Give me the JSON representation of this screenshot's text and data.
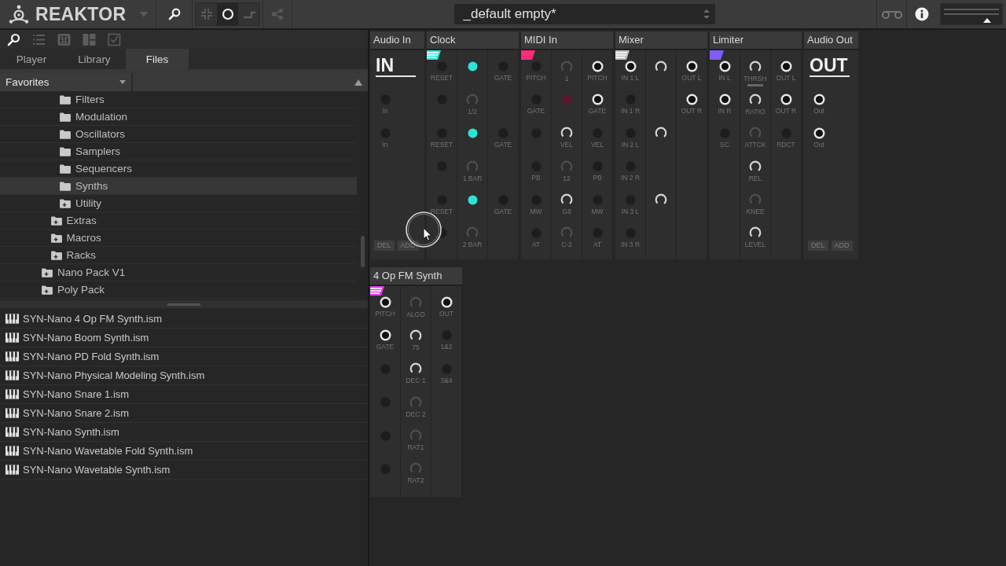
{
  "top_bar": {
    "app_name": "REAKTOR",
    "view_buttons": [
      {
        "selected": false
      },
      {
        "selected": true
      },
      {
        "selected": false
      }
    ],
    "share_button": {
      "disabled": true
    },
    "snapshot": "_default empty*",
    "master_volume": {
      "level": 0.75
    }
  },
  "browser": {
    "toolbar": [
      {
        "selected": true
      },
      {
        "selected": false
      },
      {
        "selected": false
      },
      {
        "selected": false
      },
      {
        "selected": false
      }
    ],
    "tabs": [
      {
        "label": "Player",
        "selected": false
      },
      {
        "label": "Library",
        "selected": false
      },
      {
        "label": "Files",
        "selected": true
      }
    ],
    "location": "Favorites",
    "tree": [
      {
        "children": [
          {
            "children": [
              {
                "label": "Filters",
                "expandable": false,
                "selected": false
              },
              {
                "label": "Modulation",
                "expandable": false,
                "selected": false
              },
              {
                "label": "Oscillators",
                "expandable": false,
                "selected": false
              },
              {
                "label": "Samplers",
                "expandable": false,
                "selected": false
              },
              {
                "label": "Sequencers",
                "expandable": false,
                "selected": false
              },
              {
                "label": "Synths",
                "expandable": false,
                "selected": true
              },
              {
                "label": "Utility",
                "expandable": true,
                "selected": false
              }
            ]
          },
          {
            "label": "Extras",
            "expandable": true,
            "selected": false
          },
          {
            "label": "Macros",
            "expandable": true,
            "selected": false
          },
          {
            "label": "Racks",
            "expandable": true,
            "selected": false
          }
        ]
      },
      {
        "label": "Nano Pack V1",
        "expandable": true,
        "selected": false
      },
      {
        "label": "Poly Pack",
        "expandable": true,
        "selected": false
      }
    ],
    "files": [
      "SYN-Nano 4 Op FM Synth.ism",
      "SYN-Nano Boom Synth.ism",
      "SYN-Nano PD Fold Synth.ism",
      "SYN-Nano Physical Modeling Synth.ism",
      "SYN-Nano Snare 1.ism",
      "SYN-Nano Snare 2.ism",
      "SYN-Nano Synth.ism",
      "SYN-Nano Wavetable Fold Synth.ism",
      "SYN-Nano Wavetable Synth.ism"
    ]
  },
  "canvas": {
    "top_row": [
      {
        "title": "Audio In",
        "kind": "io",
        "big_label": "IN",
        "ports": [
          {
            "label": "In",
            "on": false
          },
          {
            "label": "In",
            "on": false
          }
        ],
        "buttons": [
          "DEL",
          "ADD"
        ]
      },
      {
        "title": "Clock",
        "kind": "panel",
        "color": "#2ee3d3",
        "striped": true,
        "columns": [
          [
            {
              "kind": "jack",
              "label": "RESET",
              "on": false
            },
            {
              "kind": "jack",
              "on": false
            },
            {
              "kind": "jack",
              "label": "RESET",
              "on": false
            },
            {
              "kind": "jack",
              "on": false
            },
            {
              "kind": "jack",
              "label": "RESET",
              "on": false
            },
            {
              "kind": "jack",
              "on": false
            }
          ],
          [
            {
              "kind": "led",
              "on": true
            },
            {
              "kind": "knob",
              "label": "1/2",
              "on": false
            },
            {
              "kind": "led",
              "on": true
            },
            {
              "kind": "knob",
              "label": "1 BAR",
              "on": false
            },
            {
              "kind": "led",
              "on": true
            },
            {
              "kind": "knob",
              "label": "2 BAR",
              "on": false
            }
          ],
          [
            {
              "kind": "jack",
              "label": "GATE",
              "on": false
            },
            {
              "kind": "blank"
            },
            {
              "kind": "jack",
              "label": "GATE",
              "on": false
            },
            {
              "kind": "blank"
            },
            {
              "kind": "jack",
              "label": "GATE",
              "on": false
            },
            {
              "kind": "blank"
            }
          ]
        ]
      },
      {
        "title": "MIDI In",
        "kind": "panel",
        "color": "#ff2a78",
        "striped": false,
        "columns": [
          [
            {
              "kind": "jack",
              "label": "PITCH",
              "on": false
            },
            {
              "kind": "jack",
              "label": "GATE",
              "on": false
            },
            {
              "kind": "jack",
              "on": false
            },
            {
              "kind": "jack",
              "label": "PB",
              "on": false
            },
            {
              "kind": "jack",
              "label": "MW",
              "on": false
            },
            {
              "kind": "jack",
              "label": "AT",
              "on": false
            }
          ],
          [
            {
              "kind": "knob",
              "label": "1",
              "on": false
            },
            {
              "kind": "led",
              "on": false
            },
            {
              "kind": "knob",
              "label": "VEL",
              "on": true
            },
            {
              "kind": "knob",
              "label": "12",
              "on": false
            },
            {
              "kind": "knob",
              "label": "G8",
              "on": true
            },
            {
              "kind": "knob",
              "label": "C-2",
              "on": false
            }
          ],
          [
            {
              "kind": "jack",
              "label": "PITCH",
              "on": true
            },
            {
              "kind": "jack",
              "label": "GATE",
              "on": true
            },
            {
              "kind": "jack",
              "label": "VEL",
              "on": false
            },
            {
              "kind": "jack",
              "label": "PB",
              "on": false
            },
            {
              "kind": "jack",
              "label": "MW",
              "on": false
            },
            {
              "kind": "jack",
              "label": "AT",
              "on": false
            }
          ]
        ]
      },
      {
        "title": "Mixer",
        "kind": "panel",
        "color": "#bdbdbd",
        "striped": true,
        "columns": [
          [
            {
              "kind": "jack",
              "label": "IN 1 L",
              "on": true
            },
            {
              "kind": "jack",
              "label": "IN 1 R",
              "on": false
            },
            {
              "kind": "jack",
              "label": "IN 2 L",
              "on": false
            },
            {
              "kind": "jack",
              "label": "IN 2 R",
              "on": false
            },
            {
              "kind": "jack",
              "label": "IN 3 L",
              "on": false
            },
            {
              "kind": "jack",
              "label": "IN 3 R",
              "on": false
            }
          ],
          [
            {
              "kind": "knob",
              "on": true
            },
            {
              "kind": "blank"
            },
            {
              "kind": "knob",
              "on": true
            },
            {
              "kind": "blank"
            },
            {
              "kind": "knob",
              "on": true
            },
            {
              "kind": "blank"
            }
          ],
          [
            {
              "kind": "jack",
              "label": "OUT L",
              "on": true
            },
            {
              "kind": "jack",
              "label": "OUT R",
              "on": true
            }
          ]
        ]
      },
      {
        "title": "Limiter",
        "kind": "panel",
        "color": "#7f5cff",
        "striped": false,
        "columns": [
          [
            {
              "kind": "jack",
              "label": "IN L",
              "on": true
            },
            {
              "kind": "jack",
              "label": "IN R",
              "on": true
            },
            {
              "kind": "jack",
              "label": "SC",
              "on": false
            }
          ],
          [
            {
              "kind": "knob",
              "label": "THRSH",
              "on": true,
              "meter": true
            },
            {
              "kind": "knob",
              "label": "RATIO",
              "on": true
            },
            {
              "kind": "knob",
              "label": "ATTCK",
              "on": false
            },
            {
              "kind": "knob",
              "label": "REL",
              "on": true
            },
            {
              "kind": "knob",
              "label": "KNEE",
              "on": false
            },
            {
              "kind": "knob",
              "label": "LEVEL",
              "on": true
            }
          ],
          [
            {
              "kind": "jack",
              "label": "OUT L",
              "on": true
            },
            {
              "kind": "jack",
              "label": "OUT R",
              "on": true
            },
            {
              "kind": "jack",
              "label": "RDCT",
              "on": false
            }
          ]
        ]
      },
      {
        "title": "Audio Out",
        "kind": "io",
        "big_label": "OUT",
        "ports": [
          {
            "label": "Out",
            "on": true
          },
          {
            "label": "Out",
            "on": true
          }
        ],
        "buttons": [
          "DEL",
          "ADD"
        ]
      }
    ],
    "second_row": [
      {
        "title": "4 Op FM Synth",
        "kind": "panel",
        "color": "#e03ee6",
        "striped": true,
        "columns": [
          [
            {
              "kind": "jack",
              "label": "PITCH",
              "on": true
            },
            {
              "kind": "jack",
              "label": "GATE",
              "on": true
            },
            {
              "kind": "jack",
              "on": false
            },
            {
              "kind": "jack",
              "on": false
            },
            {
              "kind": "jack",
              "on": false
            },
            {
              "kind": "jack",
              "on": false
            }
          ],
          [
            {
              "kind": "knob",
              "label": "ALGO",
              "on": false
            },
            {
              "kind": "knob",
              "label": "75",
              "on": true
            },
            {
              "kind": "knob",
              "label": "DEC 1",
              "on": true
            },
            {
              "kind": "knob",
              "label": "DEC 2",
              "on": false
            },
            {
              "kind": "knob",
              "label": "RAT1",
              "on": false
            },
            {
              "kind": "knob",
              "label": "RAT2",
              "on": false
            }
          ],
          [
            {
              "kind": "jack",
              "label": "OUT",
              "on": true
            },
            {
              "kind": "jack",
              "label": "1&2",
              "on": false
            },
            {
              "kind": "jack",
              "label": "3&4",
              "on": false
            }
          ]
        ]
      }
    ]
  }
}
